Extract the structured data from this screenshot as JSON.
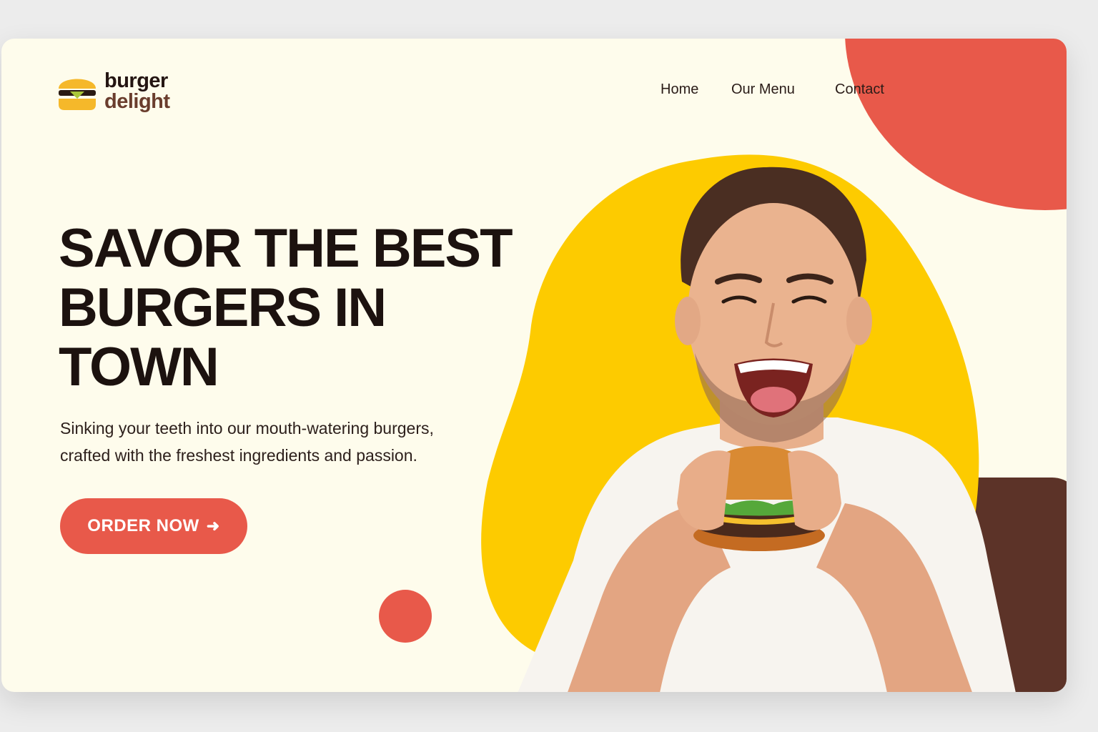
{
  "brand": {
    "line1": "burger",
    "line2": "delight"
  },
  "nav": {
    "home": "Home",
    "menu": "Our Menu",
    "contact": "Contact"
  },
  "hero": {
    "headline": [
      "SAVOR THE BEST",
      "BURGERS IN",
      "TOWN"
    ],
    "subtext": [
      "Sinking your teeth into our mouth-watering burgers,",
      "crafted with the freshest ingredients and passion."
    ],
    "cta_label": "ORDER NOW",
    "cta_icon": "arrow-right-icon"
  },
  "colors": {
    "background": "#fefcec",
    "accent_red": "#e8594a",
    "accent_yellow": "#fdcb00",
    "accent_brown": "#5c3328",
    "text_dark": "#1c120f"
  }
}
